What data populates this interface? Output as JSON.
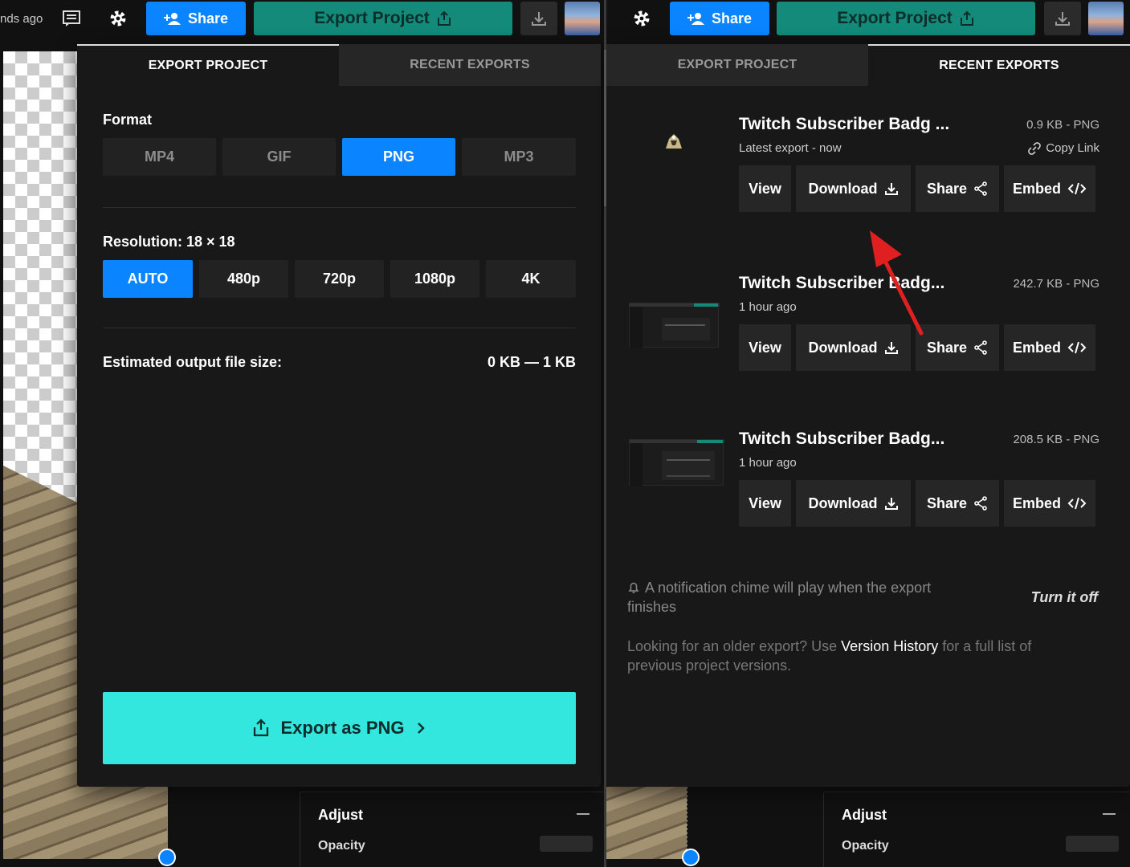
{
  "topbar": {
    "saved_text": "nds ago",
    "share_label": "Share",
    "export_label": "Export Project"
  },
  "tabs": {
    "export_project": "EXPORT PROJECT",
    "recent_exports": "RECENT EXPORTS"
  },
  "export": {
    "format_label": "Format",
    "formats": [
      "MP4",
      "GIF",
      "PNG",
      "MP3"
    ],
    "selected_format": "PNG",
    "resolution_label": "Resolution:",
    "resolution_value": "18 × 18",
    "resolutions": [
      "AUTO",
      "480p",
      "720p",
      "1080p",
      "4K"
    ],
    "selected_resolution": "AUTO",
    "estimate_label": "Estimated output file size:",
    "estimate_value": "0 KB — 1 KB",
    "button_label": "Export as PNG"
  },
  "recent": {
    "items": [
      {
        "title": "Twitch Subscriber Badg ...",
        "meta": "0.9 KB - PNG",
        "sub": "Latest export - now",
        "copy_link": "Copy Link"
      },
      {
        "title": "Twitch Subscriber Badg...",
        "meta": "242.7 KB - PNG",
        "sub": "1 hour ago"
      },
      {
        "title": "Twitch Subscriber Badg...",
        "meta": "208.5 KB - PNG",
        "sub": "1 hour ago"
      }
    ],
    "actions": {
      "view": "View",
      "download": "Download",
      "share": "Share",
      "embed": "Embed"
    },
    "notification": "A notification chime will play when the export finishes",
    "turn_off": "Turn it off",
    "older_prefix": "Looking for an older export? Use ",
    "older_link": "Version History",
    "older_suffix": " for a full list of previous project versions."
  },
  "adjust": {
    "title": "Adjust",
    "opacity_label": "Opacity"
  },
  "colors": {
    "accent_blue": "#0a84ff",
    "export_teal": "#138a7a",
    "export_cta": "#33e6de",
    "annotation_red": "#e02020"
  }
}
